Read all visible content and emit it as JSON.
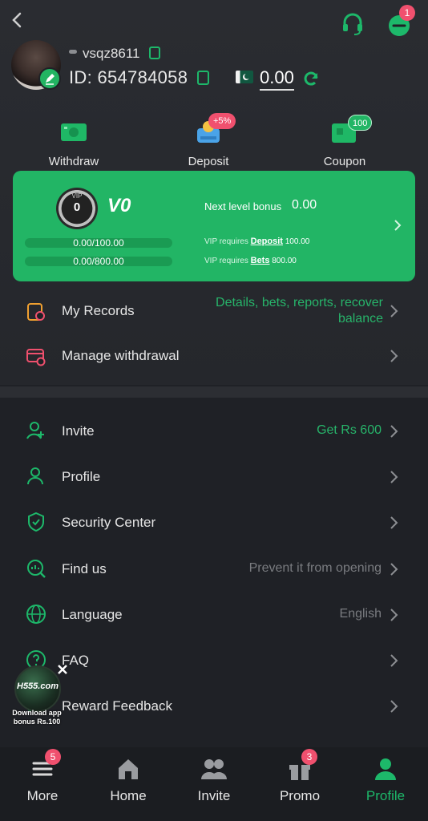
{
  "header": {
    "back_icon": "chevron-left-icon",
    "support_icon": "headset-icon",
    "message_icon": "chat-icon",
    "message_badge": "1"
  },
  "user": {
    "username": "vsqz8611",
    "id_label": "ID:",
    "id": "654784058",
    "balance": "0.00",
    "currency_flag": "pakistan-flag-icon"
  },
  "actions": [
    {
      "label": "Withdraw",
      "icon": "withdraw-icon"
    },
    {
      "label": "Deposit",
      "icon": "deposit-icon",
      "badge": "+5%"
    },
    {
      "label": "Coupon",
      "icon": "coupon-icon",
      "badge": "100"
    }
  ],
  "vip": {
    "medal_label": "VIP",
    "medal_number": "0",
    "level": "V0",
    "progress1": "0.00/100.00",
    "progress1_fraction": 0,
    "progress2": "0.00/800.00",
    "progress2_fraction": 0,
    "next_level_label": "Next level bonus",
    "next_level_value": "0.00",
    "row1_prefix": "VIP requires",
    "row1_link": "Deposit",
    "row1_amount": "100.00",
    "row2_prefix": "VIP requires",
    "row2_link": "Bets",
    "row2_amount": "800.00"
  },
  "records": [
    {
      "label": "My Records",
      "right": "Details, bets, reports, recover balance",
      "icon": "records-icon"
    },
    {
      "label": "Manage withdrawal",
      "right": "",
      "icon": "card-settings-icon"
    }
  ],
  "menu": [
    {
      "label": "Invite",
      "right": "Get Rs 600",
      "icon": "invite-icon",
      "accent": true
    },
    {
      "label": "Profile",
      "right": "",
      "icon": "profile-icon"
    },
    {
      "label": "Security Center",
      "right": "",
      "icon": "shield-icon"
    },
    {
      "label": "Find us",
      "right": "Prevent it from opening",
      "icon": "find-us-icon"
    },
    {
      "label": "Language",
      "right": "English",
      "icon": "globe-icon"
    },
    {
      "label": "FAQ",
      "right": "",
      "icon": "faq-icon"
    },
    {
      "label": "Reward Feedback",
      "right": "",
      "icon": "feedback-icon"
    }
  ],
  "ad": {
    "logo_text": "H555.com",
    "line1": "Download app",
    "line2": "bonus Rs.100"
  },
  "nav": [
    {
      "label": "More",
      "icon": "menu-icon",
      "badge": "5"
    },
    {
      "label": "Home",
      "icon": "home-icon"
    },
    {
      "label": "Invite",
      "icon": "users-icon"
    },
    {
      "label": "Promo",
      "icon": "gift-icon",
      "badge": "3"
    },
    {
      "label": "Profile",
      "icon": "profile-icon",
      "active": true
    }
  ],
  "colors": {
    "accent": "#22b565",
    "background": "#1f2126",
    "badge": "#f0506e"
  }
}
